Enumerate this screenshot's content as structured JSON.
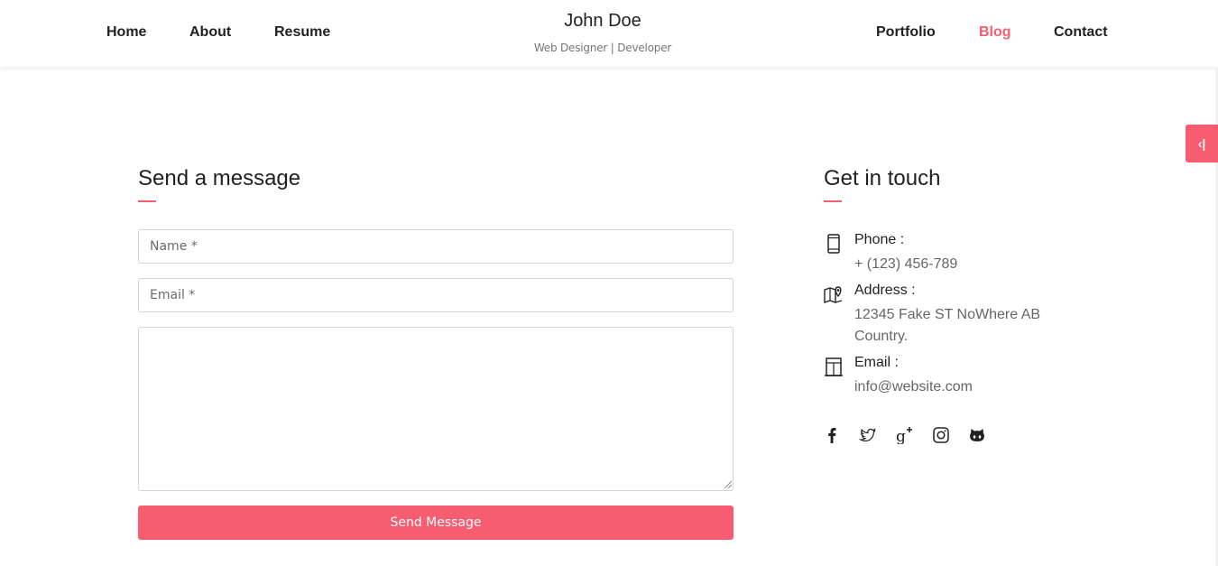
{
  "nav": {
    "left": [
      "Home",
      "About",
      "Resume"
    ],
    "right": [
      "Portfolio",
      "Blog",
      "Contact"
    ],
    "active": "Blog"
  },
  "brand": {
    "name": "John Doe",
    "tagline": "Web Designer | Developer"
  },
  "side_toggle": {
    "glyph": "‹|"
  },
  "form": {
    "title": "Send a message",
    "name_placeholder": "Name *",
    "email_placeholder": "Email *",
    "message_value": "",
    "submit_label": "Send Message"
  },
  "contact": {
    "title": "Get in touch",
    "items": [
      {
        "label": "Phone :",
        "value": "+ (123) 456-789",
        "icon": "phone-icon"
      },
      {
        "label": "Address :",
        "value": "12345 Fake ST NoWhere AB Country.",
        "icon": "map-icon"
      },
      {
        "label": "Email :",
        "value": "info@website.com",
        "icon": "email-icon"
      }
    ],
    "social": [
      "facebook-icon",
      "twitter-icon",
      "google-plus-icon",
      "instagram-icon",
      "github-icon"
    ]
  },
  "colors": {
    "accent": "#f85c70",
    "text": "#222222",
    "muted": "#666666",
    "border": "#d4d4d4"
  }
}
